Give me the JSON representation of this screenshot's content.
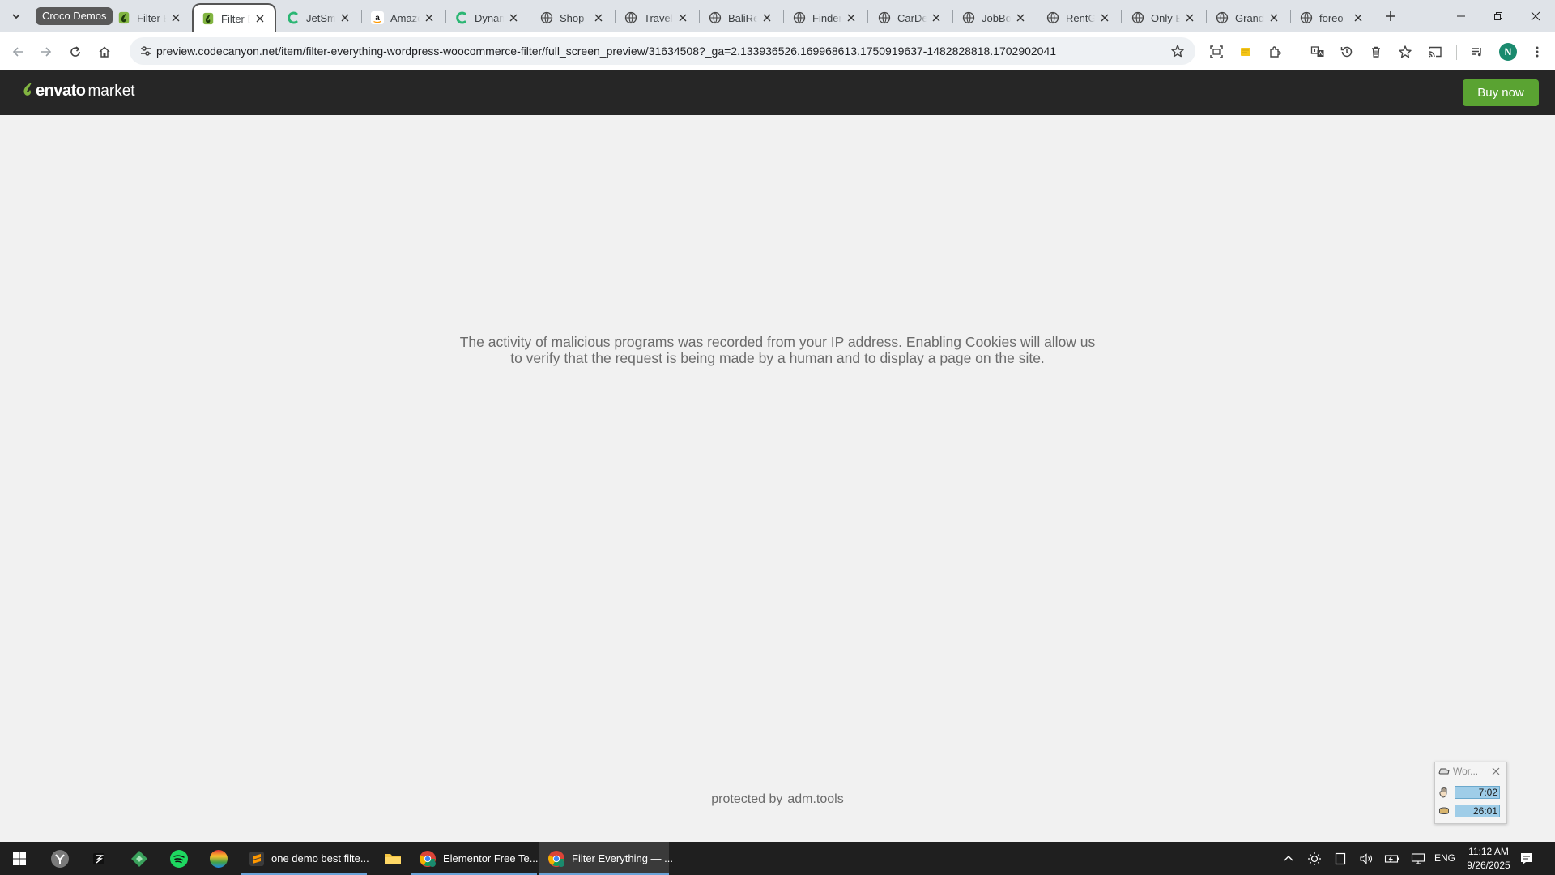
{
  "colors": {
    "envato_green": "#82b541",
    "buy_button": "#5aa332",
    "avatar": "#1a8a6e",
    "header_bg": "#262626",
    "content_bg": "#f1f1f1",
    "taskbar_accent": "#6aa3d8"
  },
  "browser": {
    "tab_group_label": "Croco Demos",
    "tabs": [
      {
        "title": "Filter Everything",
        "icon": "envato-leaf-icon",
        "active": false
      },
      {
        "title": "Filter Everything",
        "icon": "envato-leaf-icon",
        "active": true
      },
      {
        "title": "JetSmartFilters",
        "icon": "crocoblock-icon",
        "active": false
      },
      {
        "title": "Amazon",
        "icon": "amazon-icon",
        "active": false
      },
      {
        "title": "Dynamic",
        "icon": "crocoblock-icon",
        "active": false
      },
      {
        "title": "Shop",
        "icon": "globe-icon",
        "active": false
      },
      {
        "title": "Travel",
        "icon": "globe-icon",
        "active": false
      },
      {
        "title": "BaliRent",
        "icon": "globe-icon",
        "active": false
      },
      {
        "title": "Finder",
        "icon": "globe-icon",
        "active": false
      },
      {
        "title": "CarDealer",
        "icon": "globe-icon",
        "active": false
      },
      {
        "title": "JobBoard",
        "icon": "globe-icon",
        "active": false
      },
      {
        "title": "RentGo",
        "icon": "globe-icon",
        "active": false
      },
      {
        "title": "Only Events",
        "icon": "globe-icon",
        "active": false
      },
      {
        "title": "Grand",
        "icon": "globe-icon",
        "active": false
      },
      {
        "title": "foreo",
        "icon": "globe-icon",
        "active": false
      }
    ],
    "url": "preview.codecanyon.net/item/filter-everything-wordpress-woocommerce-filter/full_screen_preview/31634508?_ga=2.133936526.169968613.1750919637-1482828818.1702902041",
    "avatar_letter": "N"
  },
  "envato": {
    "logo_word": "envato",
    "logo_market": "market",
    "buy_label": "Buy now"
  },
  "page": {
    "notice_line1": "The activity of malicious programs was recorded from your IP address. Enabling Cookies will allow us",
    "notice_line2": "to verify that the request is being made by a human and to display a page on the site.",
    "protected_by": "protected by",
    "protected_brand": "adm.tools"
  },
  "widget": {
    "title": "Wor...",
    "value1": "7:02",
    "value2": "26:01"
  },
  "taskbar": {
    "apps": [
      {
        "label": "one demo best filte...",
        "icon": "sublime-text-icon",
        "active": false
      },
      {
        "label": "Elementor Free Te...",
        "icon": "chrome-icon",
        "active": false
      },
      {
        "label": "Filter Everything — ...",
        "icon": "chrome-icon",
        "active": true
      }
    ],
    "language": "ENG",
    "time": "11:12 AM",
    "date": "9/26/2025"
  }
}
